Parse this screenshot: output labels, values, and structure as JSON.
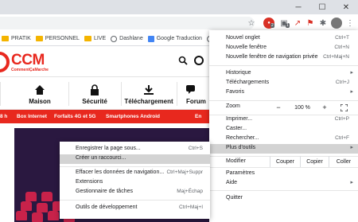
{
  "window": {
    "minimize_glyph": "─",
    "maximize_glyph": "☐",
    "close_glyph": "✕"
  },
  "toolbar": {
    "extension_badges": [
      "2",
      "1"
    ]
  },
  "bookmarks": [
    {
      "label": "PRATIK",
      "icon": "folder-icon"
    },
    {
      "label": "PERSONNEL",
      "icon": "folder-icon"
    },
    {
      "label": "LIVE",
      "icon": "folder-icon"
    },
    {
      "label": "Dashlane",
      "icon": "globe-icon"
    },
    {
      "label": "Google Traduction",
      "icon": "translate-icon"
    },
    {
      "label": "O",
      "icon": "globe-icon"
    }
  ],
  "site": {
    "logo_text": "CCM",
    "logo_sub": "CommentÇaMarche",
    "nav": [
      {
        "label": "Maison",
        "icon": "house-icon"
      },
      {
        "label": "Sécurité",
        "icon": "lock-icon"
      },
      {
        "label": "Téléchargement",
        "icon": "download-icon"
      },
      {
        "label": "Forum",
        "icon": "chat-icon"
      }
    ],
    "redbar": [
      "8 h",
      "Box Internet",
      "Forfaits 4G et 5G",
      "Smartphones Android",
      "En"
    ]
  },
  "menu": {
    "items": [
      {
        "label": "Nouvel onglet",
        "shortcut": "Ctrl+T"
      },
      {
        "label": "Nouvelle fenêtre",
        "shortcut": "Ctrl+N"
      },
      {
        "label": "Nouvelle fenêtre de navigation privée",
        "shortcut": "Ctrl+Maj+N"
      },
      {
        "label": "Historique",
        "shortcut": ""
      },
      {
        "label": "Téléchargements",
        "shortcut": "Ctrl+J"
      },
      {
        "label": "Favoris",
        "shortcut": ""
      },
      {
        "label": "Zoom",
        "shortcut": ""
      },
      {
        "label": "Imprimer...",
        "shortcut": "Ctrl+P"
      },
      {
        "label": "Caster...",
        "shortcut": ""
      },
      {
        "label": "Rechercher...",
        "shortcut": "Ctrl+F"
      },
      {
        "label": "Plus d'outils",
        "shortcut": ""
      },
      {
        "label": "Modifier",
        "shortcut": ""
      },
      {
        "label": "Paramètres",
        "shortcut": ""
      },
      {
        "label": "Aide",
        "shortcut": ""
      },
      {
        "label": "Quitter",
        "shortcut": ""
      }
    ],
    "zoom": {
      "minus": "−",
      "value": "100 %",
      "plus": "+"
    },
    "edit": {
      "cut": "Couper",
      "copy": "Copier",
      "paste": "Coller"
    },
    "arrow": "▸"
  },
  "submenu": {
    "items": [
      {
        "label": "Enregistrer la page sous...",
        "shortcut": "Ctrl+S"
      },
      {
        "label": "Créer un raccourci...",
        "shortcut": ""
      },
      {
        "label": "Effacer les données de navigation...",
        "shortcut": "Ctrl+Maj+Suppr"
      },
      {
        "label": "Extensions",
        "shortcut": ""
      },
      {
        "label": "Gestionnaire de tâches",
        "shortcut": "Maj+Échap"
      },
      {
        "label": "Outils de développement",
        "shortcut": "Ctrl+Maj+I"
      }
    ]
  }
}
